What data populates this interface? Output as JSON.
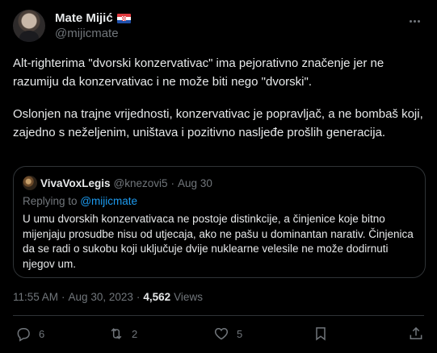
{
  "author": {
    "name": "Mate Mijić",
    "handle": "@mijicmate",
    "flag_icon": "croatia-flag-icon"
  },
  "tweet": {
    "paragraph1": "Alt-righterima \"dvorski konzervativac\" ima pejorativno značenje jer ne razumiju da konzervativac i ne može biti nego \"dvorski\".",
    "paragraph2": "Oslonjen na trajne vrijednosti, konzervativac je popravljač, a ne bombaš koji, zajedno s neželjenim, uništava i pozitivno nasljeđe prošlih generacija."
  },
  "quoted": {
    "name": "VivaVoxLegis",
    "handle": "@knezovi5",
    "separator": "·",
    "date": "Aug 30",
    "replying_prefix": "Replying to",
    "replying_to": "@mijicmate",
    "text": "U umu dvorskih konzervativaca ne postoje distinkcije, a činjenice koje bitno mijenjaju prosudbe nisu od utjecaja, ako ne pašu u dominantan narativ. Činjenica da se radi o sukobu koji uključuje dvije nuklearne velesile ne može dodirnuti njegov um."
  },
  "meta": {
    "time": "11:55 AM",
    "sep1": "·",
    "date": "Aug 30, 2023",
    "sep2": "·",
    "views_count": "4,562",
    "views_label": "Views"
  },
  "actions": {
    "replies": "6",
    "retweets": "2",
    "likes": "5"
  },
  "colors": {
    "background": "#000000",
    "text": "#e7e9ea",
    "muted": "#71767b",
    "link": "#1d9bf0",
    "border": "#2f3336"
  }
}
